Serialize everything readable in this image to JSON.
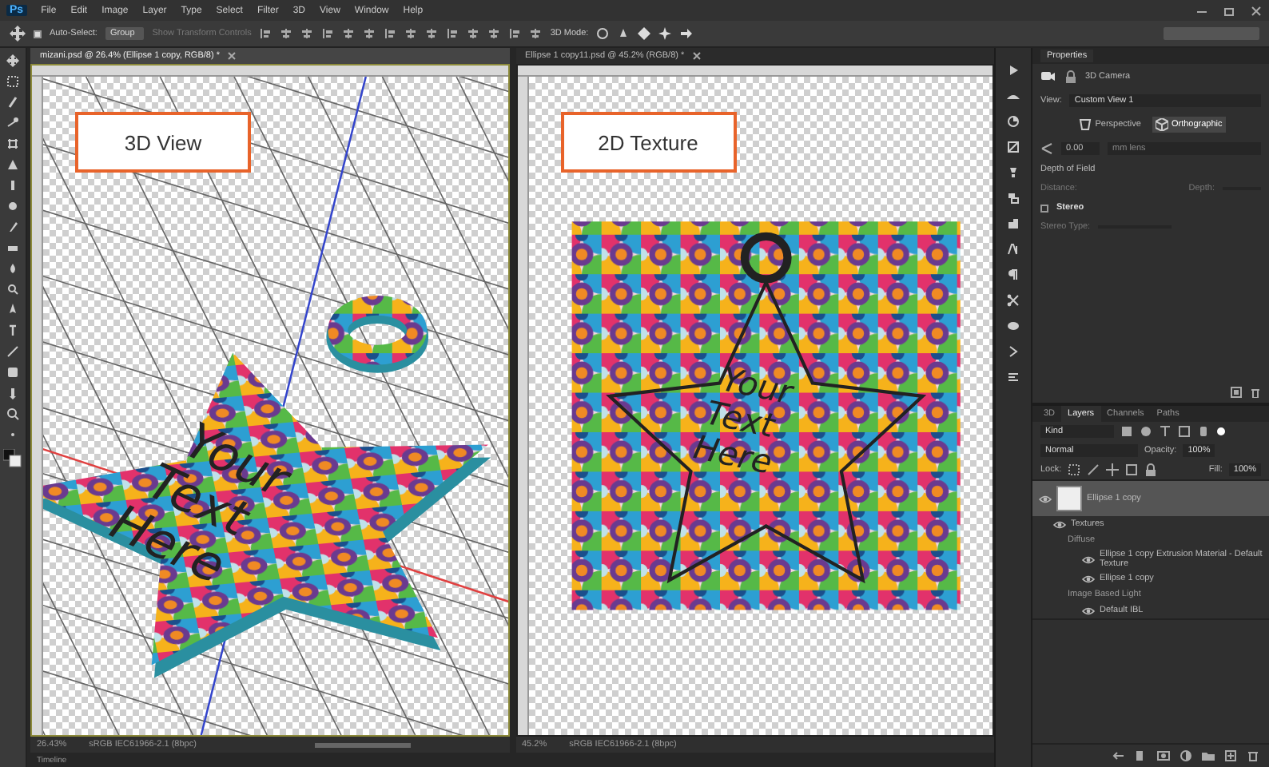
{
  "app": {
    "logo": "Ps"
  },
  "menu": [
    "File",
    "Edit",
    "Image",
    "Layer",
    "Type",
    "Select",
    "Filter",
    "3D",
    "View",
    "Window",
    "Help"
  ],
  "options": {
    "auto_select_label": "Auto-Select:",
    "auto_select_checked": true,
    "auto_select_target": "Group",
    "transform_label": "Show Transform Controls",
    "mode_label": "3D Mode:"
  },
  "documents": [
    {
      "tab": "mizani.psd @ 26.4% (Ellipse 1 copy, RGB/8) *",
      "kind": "scene",
      "selected": true,
      "callout": "3D View",
      "artwork_text": [
        "Your",
        "Text",
        "Here"
      ],
      "zoom": "26.43%",
      "profile": "sRGB IEC61966-2.1 (8bpc)"
    },
    {
      "tab": "Ellipse 1 copy11.psd @ 45.2% (RGB/8) *",
      "kind": "texture",
      "selected": false,
      "callout": "2D Texture",
      "artwork_text": [
        "Your",
        "Text",
        "Here"
      ],
      "zoom": "45.2%",
      "profile": "sRGB IEC61966-2.1 (8bpc)"
    }
  ],
  "timeline": "Timeline",
  "properties": {
    "title": "Properties",
    "section": "3D Camera",
    "view_label": "View:",
    "view_value": "Custom View 1",
    "projections": [
      {
        "label": "Perspective",
        "selected": false
      },
      {
        "label": "Orthographic",
        "selected": true
      }
    ],
    "fov_value": "0.00",
    "fov_unit": "mm lens",
    "dof_title": "Depth of Field",
    "distance_label": "Distance:",
    "depth_label": "Depth:",
    "stereo": {
      "label": "Stereo",
      "checked": false
    },
    "stereo_type_label": "Stereo Type:"
  },
  "layers": {
    "tabs": [
      {
        "label": "3D",
        "selected": false
      },
      {
        "label": "Layers",
        "selected": true
      },
      {
        "label": "Channels",
        "selected": false
      },
      {
        "label": "Paths",
        "selected": false
      }
    ],
    "filter": "Kind",
    "blend": "Normal",
    "opacity_label": "Opacity:",
    "opacity": "100%",
    "lock_label": "Lock:",
    "fill_label": "Fill:",
    "fill": "100%",
    "items": [
      {
        "name": "Ellipse 1 copy",
        "kind": "layer",
        "visible": true,
        "selected": true,
        "children": [
          {
            "name": "Textures",
            "kind": "group",
            "visible": true,
            "selected": false,
            "children": [
              {
                "name": "Diffuse",
                "kind": "heading",
                "selected": false,
                "children": [
                  {
                    "name": "Ellipse 1 copy Extrusion Material - Default Texture",
                    "kind": "item",
                    "visible": true,
                    "selected": false
                  },
                  {
                    "name": "Ellipse 1 copy",
                    "kind": "item",
                    "visible": true,
                    "selected": false
                  }
                ]
              },
              {
                "name": "Image Based Light",
                "kind": "heading",
                "selected": false,
                "children": [
                  {
                    "name": "Default IBL",
                    "kind": "item",
                    "visible": true,
                    "selected": false
                  }
                ]
              }
            ]
          }
        ]
      }
    ]
  }
}
